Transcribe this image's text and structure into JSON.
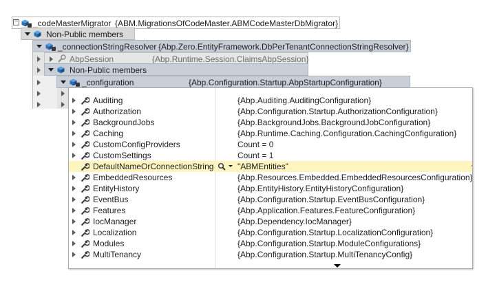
{
  "tree": {
    "root": {
      "name": "_codeMasterMigrator",
      "value": "{ABM.MigrationsOfCodeMaster.ABMCodeMasterDbMigrator}"
    },
    "nonpublic1": {
      "name": "Non-Public members"
    },
    "resolver": {
      "name": "_connectionStringResolver",
      "value": "{Abp.Zero.EntityFramework.DbPerTenantConnectionStringResolver}"
    },
    "session": {
      "name": "AbpSession",
      "value": "{Abp.Runtime.Session.ClaimsAbpSession}"
    },
    "nonpublic2": {
      "name": "Non-Public members"
    },
    "configuration": {
      "name": "_configuration",
      "value": "{Abp.Configuration.Startup.AbpStartupConfiguration}"
    }
  },
  "properties": [
    {
      "name": "Auditing",
      "value": "{Abp.Auditing.AuditingConfiguration}"
    },
    {
      "name": "Authorization",
      "value": "{Abp.Configuration.Startup.AuthorizationConfiguration}"
    },
    {
      "name": "BackgroundJobs",
      "value": "{Abp.BackgroundJobs.BackgroundJobConfiguration}"
    },
    {
      "name": "Caching",
      "value": "{Abp.Runtime.Caching.Configuration.CachingConfiguration}"
    },
    {
      "name": "CustomConfigProviders",
      "value": "Count = 0"
    },
    {
      "name": "CustomSettings",
      "value": "Count = 1"
    },
    {
      "name": "DefaultNameOrConnectionString",
      "value": "\"ABMEntities\""
    },
    {
      "name": "EmbeddedResources",
      "value": "{Abp.Resources.Embedded.EmbeddedResourcesConfiguration}"
    },
    {
      "name": "EntityHistory",
      "value": "{Abp.EntityHistory.EntityHistoryConfiguration}"
    },
    {
      "name": "EventBus",
      "value": "{Abp.Configuration.Startup.EventBusConfiguration}"
    },
    {
      "name": "Features",
      "value": "{Abp.Application.Features.FeatureConfiguration}"
    },
    {
      "name": "IocManager",
      "value": "{Abp.Dependency.IocManager}"
    },
    {
      "name": "Localization",
      "value": "{Abp.Configuration.Startup.LocalizationConfiguration}"
    },
    {
      "name": "Modules",
      "value": "{Abp.Configuration.Startup.ModuleConfigurations}"
    },
    {
      "name": "MultiTenancy",
      "value": "{Abp.Configuration.Startup.MultiTenancyConfig}"
    }
  ],
  "icons": {
    "expand": "triangle-right-icon",
    "collapse": "triangle-down-icon",
    "property": "wrench-icon",
    "field": "cube-icon",
    "private": "lock-icon",
    "search": "magnifier-icon",
    "pin": "pin-icon",
    "more": "scroll-down-icon"
  },
  "colors": {
    "selected_row": "#fdf4bf",
    "header_row": "#c9cfd8",
    "cube_blue": "#2c6fb4"
  }
}
